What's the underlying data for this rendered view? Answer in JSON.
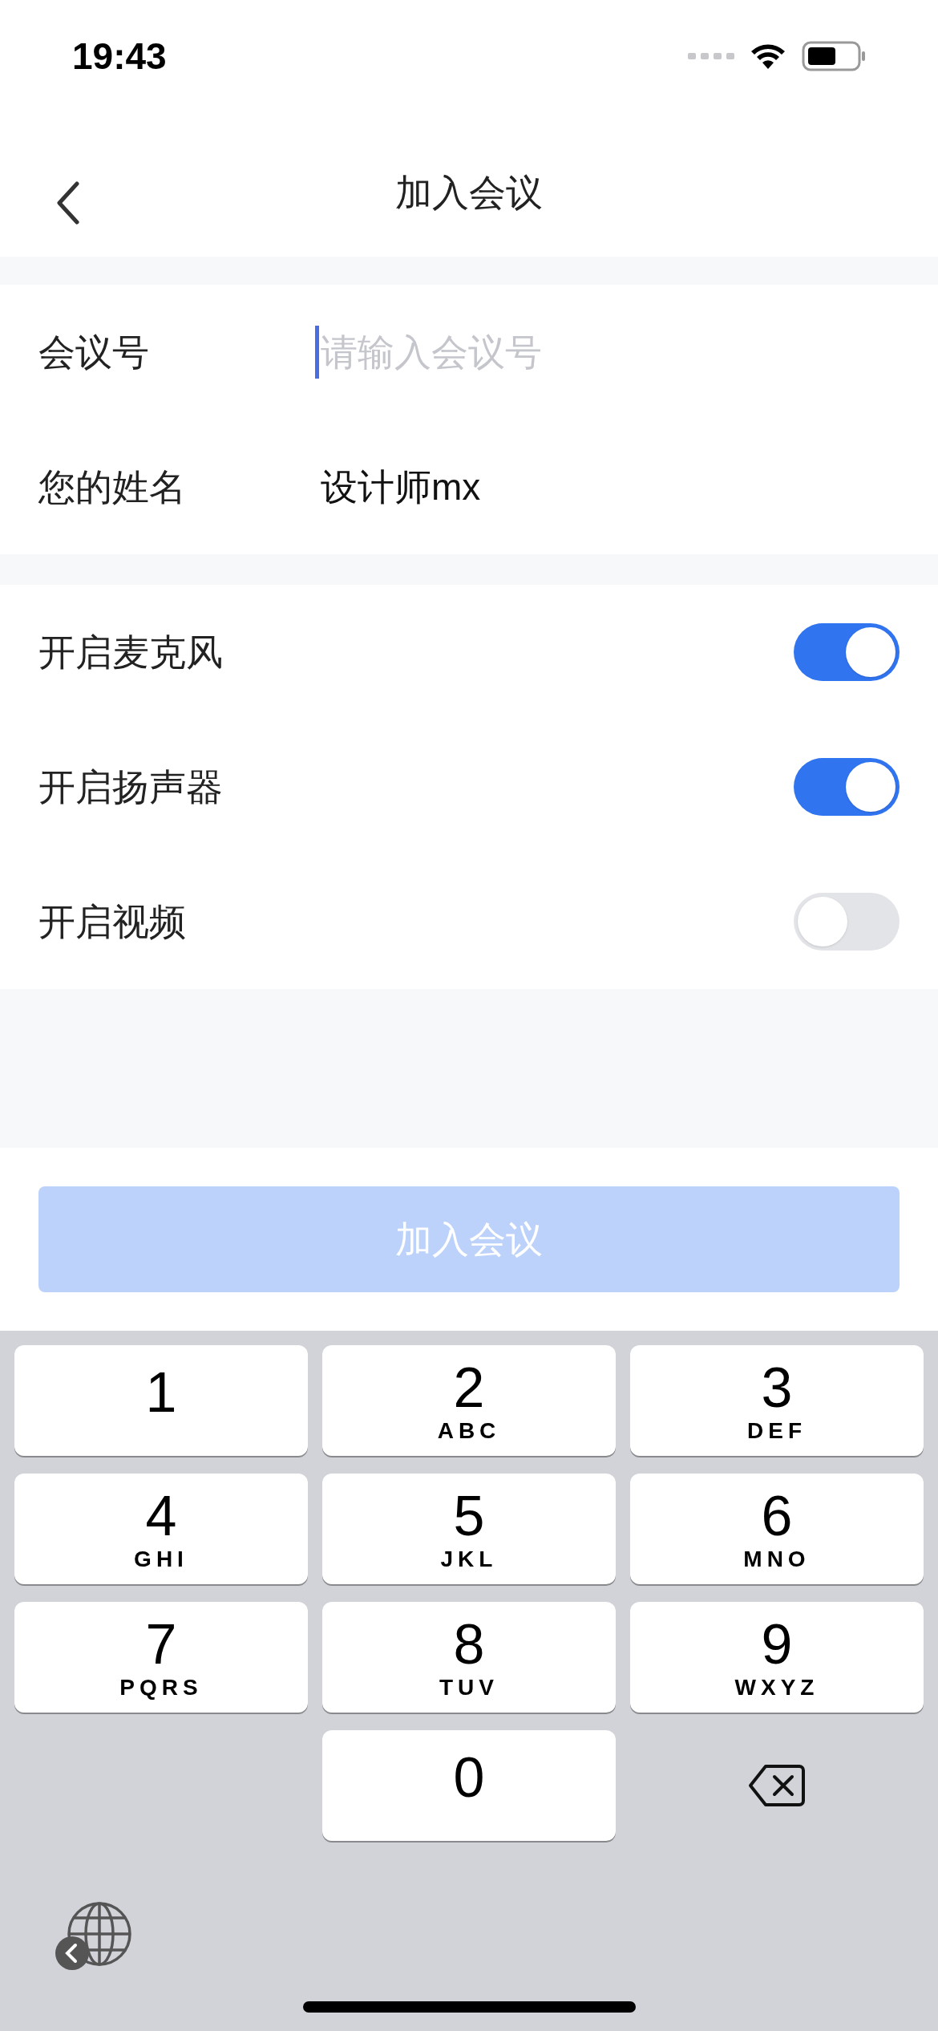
{
  "status_bar": {
    "time": "19:43"
  },
  "nav": {
    "title": "加入会议"
  },
  "fields": [
    {
      "label": "会议号",
      "placeholder": "请输入会议号",
      "focused": true
    },
    {
      "label": "您的姓名",
      "value": "设计师mx",
      "focused": false
    }
  ],
  "toggles": [
    {
      "label": "开启麦克风",
      "on": true
    },
    {
      "label": "开启扬声器",
      "on": true
    },
    {
      "label": "开启视频",
      "on": false
    }
  ],
  "join_button": {
    "label": "加入会议",
    "disabled": true
  },
  "keyboard": {
    "keys": [
      {
        "digit": "1"
      },
      {
        "digit": "2",
        "letters": "ABC"
      },
      {
        "digit": "3",
        "letters": "DEF"
      },
      {
        "digit": "4",
        "letters": "GHI"
      },
      {
        "digit": "5",
        "letters": "JKL"
      },
      {
        "digit": "6",
        "letters": "MNO"
      },
      {
        "digit": "7",
        "letters": "PQRS"
      },
      {
        "digit": "8",
        "letters": "TUV"
      },
      {
        "digit": "9",
        "letters": "WXYZ"
      },
      {
        "digit": "0"
      }
    ]
  }
}
